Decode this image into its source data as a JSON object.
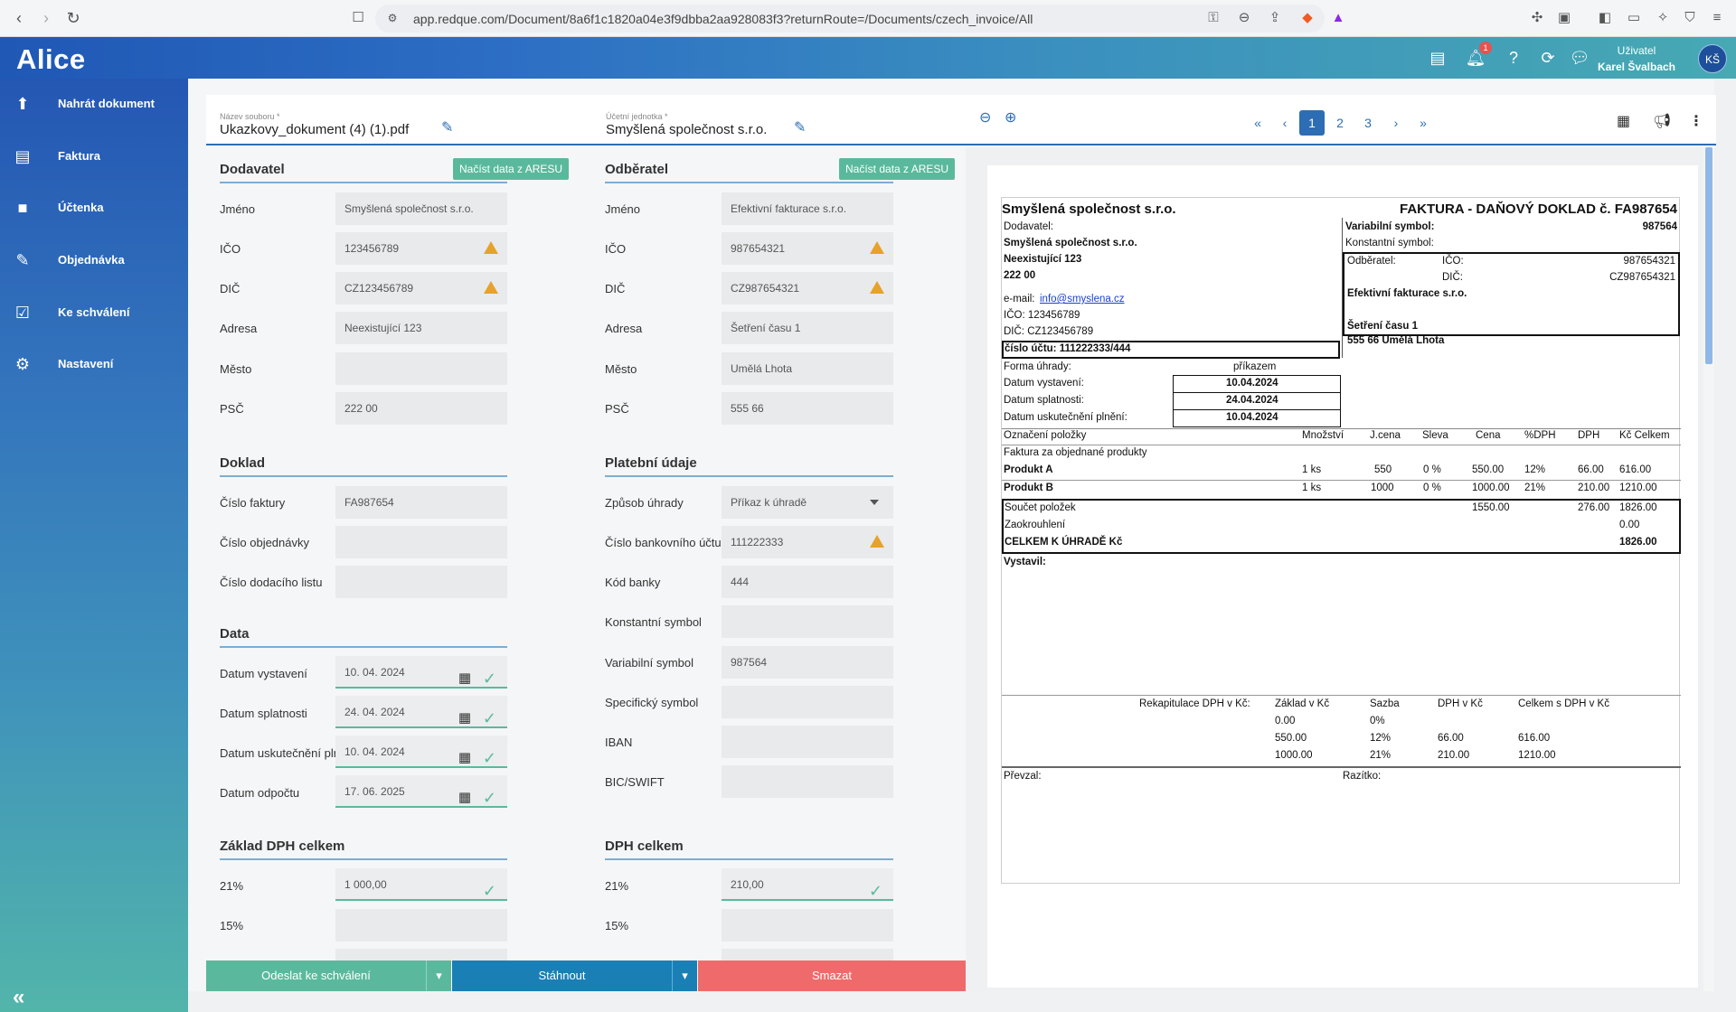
{
  "browser": {
    "url": "app.redque.com/Document/8a6f1c1820a04e3f9dbba2aa928083f3?returnRoute=/Documents/czech_invoice/All"
  },
  "app": {
    "logo": "Alice",
    "user_label": "Uživatel",
    "user_name": "Karel Švalbach",
    "avatar": "KŠ",
    "notifications": "1"
  },
  "sidebar": {
    "items": [
      {
        "label": "Nahrát dokument",
        "icon": "upload-file-icon"
      },
      {
        "label": "Faktura",
        "icon": "document-icon"
      },
      {
        "label": "Účtenka",
        "icon": "receipt-icon"
      },
      {
        "label": "Objednávka",
        "icon": "order-icon"
      },
      {
        "label": "Ke schválení",
        "icon": "approval-icon"
      },
      {
        "label": "Nastavení",
        "icon": "gear-icon"
      }
    ]
  },
  "toolbar": {
    "file_label": "Název souboru *",
    "file_name": "Ukazkovy_dokument (4) (1).pdf",
    "unit_label": "Účetní jednotka *",
    "unit_name": "Smyšlená společnost s.r.o.",
    "pages": [
      "1",
      "2",
      "3"
    ],
    "current_page": "1"
  },
  "supplier": {
    "title": "Dodavatel",
    "ares": "Načíst data z ARESU",
    "fields": [
      {
        "label": "Jméno",
        "value": "Smyšlená společnost s.r.o."
      },
      {
        "label": "IČO",
        "value": "123456789"
      },
      {
        "label": "DIČ",
        "value": "CZ123456789"
      },
      {
        "label": "Adresa",
        "value": "Neexistující 123"
      },
      {
        "label": "Město",
        "value": ""
      },
      {
        "label": "PSČ",
        "value": "222 00"
      }
    ]
  },
  "customer": {
    "title": "Odběratel",
    "ares": "Načíst data z ARESU",
    "fields": [
      {
        "label": "Jméno",
        "value": "Efektivní fakturace s.r.o."
      },
      {
        "label": "IČO",
        "value": "987654321"
      },
      {
        "label": "DIČ",
        "value": "CZ987654321"
      },
      {
        "label": "Adresa",
        "value": "Šetření času 1"
      },
      {
        "label": "Město",
        "value": "Umělá Lhota"
      },
      {
        "label": "PSČ",
        "value": "555 66"
      }
    ]
  },
  "doklad": {
    "title": "Doklad",
    "fields": [
      {
        "label": "Číslo faktury",
        "value": "FA987654"
      },
      {
        "label": "Číslo objednávky",
        "value": ""
      },
      {
        "label": "Číslo dodacího listu",
        "value": ""
      }
    ]
  },
  "payment": {
    "title": "Platební údaje",
    "fields": [
      {
        "label": "Způsob úhrady",
        "value": "Příkaz k úhradě"
      },
      {
        "label": "Číslo bankovního účtu",
        "value": "111222333"
      },
      {
        "label": "Kód banky",
        "value": "444"
      },
      {
        "label": "Konstantní symbol",
        "value": ""
      },
      {
        "label": "Variabilní symbol",
        "value": "987564"
      },
      {
        "label": "Specifický symbol",
        "value": ""
      },
      {
        "label": "IBAN",
        "value": ""
      },
      {
        "label": "BIC/SWIFT",
        "value": ""
      }
    ]
  },
  "dates": {
    "title": "Data",
    "fields": [
      {
        "label": "Datum vystavení",
        "value": "10. 04. 2024"
      },
      {
        "label": "Datum splatnosti",
        "value": "24. 04. 2024"
      },
      {
        "label": "Datum uskutečnění pln...",
        "value": "10. 04. 2024"
      },
      {
        "label": "Datum odpočtu",
        "value": "17. 06. 2025"
      }
    ]
  },
  "vat_base": {
    "title": "Základ DPH celkem",
    "fields": [
      {
        "label": "21%",
        "value": "1  000,00"
      },
      {
        "label": "15%",
        "value": ""
      }
    ]
  },
  "vat_total": {
    "title": "DPH celkem",
    "fields": [
      {
        "label": "21%",
        "value": "210,00"
      },
      {
        "label": "15%",
        "value": ""
      }
    ]
  },
  "buttons": {
    "send": "Odeslat ke schválení",
    "download": "Stáhnout",
    "delete": "Smazat"
  },
  "invoice": {
    "seller": "Smyšlená společnost s.r.o.",
    "heading": "FAKTURA - DAŇOVÝ DOKLAD č. FA987654",
    "dodavatel_lbl": "Dodavatel:",
    "seller_name": "Smyšlená společnost s.r.o.",
    "seller_street": "Neexistující 123",
    "seller_zip": "222 00",
    "email_lbl": "e-mail:",
    "email": "info@smyslena.cz",
    "ico_line": "IČO: 123456789",
    "dic_line": "DIČ: CZ123456789",
    "account": "číslo účtu: 111222333/444",
    "vs_lbl": "Variabilní symbol:",
    "vs": "987564",
    "ks_lbl": "Konstantní symbol:",
    "odb_lbl": "Odběratel:",
    "ico_lbl": "IČO:",
    "ico": "987654321",
    "dic_lbl": "DIČ:",
    "dic": "CZ987654321",
    "buyer_name": "Efektivní fakturace s.r.o.",
    "buyer_street": "Šetření času 1",
    "buyer_city": "555 66 Umělá Lhota",
    "pay_lbl": "Forma úhrady:",
    "pay": "příkazem",
    "issue_lbl": "Datum vystavení:",
    "issue": "10.04.2024",
    "due_lbl": "Datum splatnosti:",
    "due": "24.04.2024",
    "tax_lbl": "Datum uskutečnění plnění:",
    "tax": "10.04.2024",
    "cols": [
      "Označení položky",
      "Množství",
      "J.cena",
      "Sleva",
      "Cena",
      "%DPH",
      "DPH",
      "Kč Celkem"
    ],
    "intro": "Faktura za objednané produkty",
    "rows": [
      [
        "Produkt A",
        "1 ks",
        "550",
        "0 %",
        "550.00",
        "12%",
        "66.00",
        "616.00"
      ],
      [
        "Produkt B",
        "1 ks",
        "1000",
        "0 %",
        "1000.00",
        "21%",
        "210.00",
        "1210.00"
      ]
    ],
    "sum_lbl": "Součet položek",
    "sum_price": "1550.00",
    "sum_vat": "276.00",
    "sum_total": "1826.00",
    "round_lbl": "Zaokrouhlení",
    "round": "0.00",
    "total_lbl": "CELKEM K ÚHRADĚ Kč",
    "total": "1826.00",
    "issued_by": "Vystavil:",
    "recap_lbl": "Rekapitulace DPH v Kč:",
    "recap_cols": [
      "Základ v Kč",
      "Sazba",
      "DPH v Kč",
      "Celkem s DPH v Kč"
    ],
    "recap": [
      [
        "0.00",
        "0%",
        "",
        ""
      ],
      [
        "550.00",
        "12%",
        "66.00",
        "616.00"
      ],
      [
        "1000.00",
        "21%",
        "210.00",
        "1210.00"
      ]
    ],
    "received": "Převzal:",
    "stamp": "Razítko:"
  }
}
